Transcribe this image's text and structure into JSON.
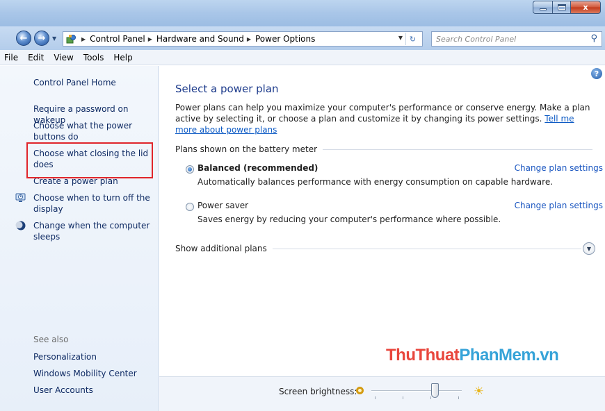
{
  "window": {
    "controls": {
      "minimize": "",
      "maximize": "",
      "close": "x"
    }
  },
  "nav": {
    "breadcrumbs": [
      "Control Panel",
      "Hardware and Sound",
      "Power Options"
    ],
    "search_placeholder": "Search Control Panel"
  },
  "menu": [
    "File",
    "Edit",
    "View",
    "Tools",
    "Help"
  ],
  "sidebar": {
    "home": "Control Panel Home",
    "links": [
      "Require a password on wakeup",
      "Choose what the power buttons do",
      "Choose what closing the lid does",
      "Create a power plan",
      "Choose when to turn off the display",
      "Change when the computer sleeps"
    ],
    "see_also_label": "See also",
    "see_also": [
      "Personalization",
      "Windows Mobility Center",
      "User Accounts"
    ]
  },
  "main": {
    "title": "Select a power plan",
    "intro": "Power plans can help you maximize your computer's performance or conserve energy. Make a plan active by selecting it, or choose a plan and customize it by changing its power settings.",
    "intro_link": "Tell me more about power plans",
    "group_label": "Plans shown on the battery meter",
    "plans": [
      {
        "name": "Balanced (recommended)",
        "description": "Automatically balances performance with energy consumption on capable hardware.",
        "selected": true,
        "link": "Change plan settings"
      },
      {
        "name": "Power saver",
        "description": "Saves energy by reducing your computer's performance where possible.",
        "selected": false,
        "link": "Change plan settings"
      }
    ],
    "additional_label": "Show additional plans"
  },
  "footer": {
    "brightness_label": "Screen brightness:",
    "brightness_level": 0.7
  },
  "watermark": {
    "part1": "ThuThuat",
    "part2": "PhanMem.vn"
  },
  "colors": {
    "highlight_box": "#e0252b",
    "link": "#0e2a63",
    "title": "#1e3c8c"
  }
}
